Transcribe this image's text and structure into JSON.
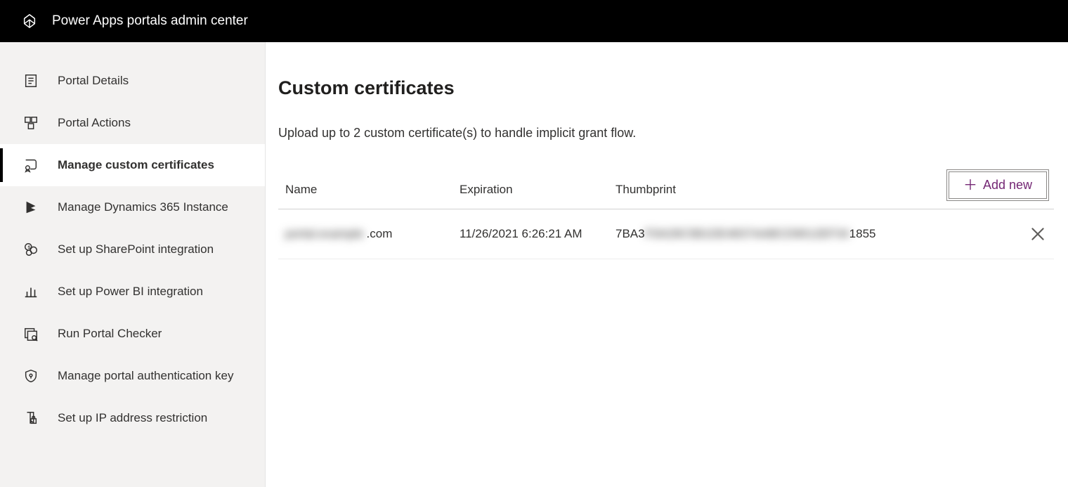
{
  "header": {
    "brand": "Power Apps portals admin center"
  },
  "sidebar": {
    "items": [
      {
        "label": "Portal Details",
        "icon": "details-icon"
      },
      {
        "label": "Portal Actions",
        "icon": "actions-icon"
      },
      {
        "label": "Manage custom certificates",
        "icon": "certificate-icon",
        "active": true
      },
      {
        "label": "Manage Dynamics 365 Instance",
        "icon": "dynamics-icon"
      },
      {
        "label": "Set up SharePoint integration",
        "icon": "sharepoint-icon"
      },
      {
        "label": "Set up Power BI integration",
        "icon": "powerbi-icon"
      },
      {
        "label": "Run Portal Checker",
        "icon": "checker-icon"
      },
      {
        "label": "Manage portal authentication key",
        "icon": "shield-icon"
      },
      {
        "label": "Set up IP address restriction",
        "icon": "ip-restriction-icon"
      }
    ]
  },
  "main": {
    "title": "Custom certificates",
    "subtitle": "Upload up to 2 custom certificate(s) to handle implicit grant flow.",
    "addButton": "Add new",
    "columns": {
      "name": "Name",
      "expiration": "Expiration",
      "thumbprint": "Thumbprint"
    },
    "rows": [
      {
        "name_hidden": "portal.example",
        "name_suffix": ".com",
        "expiration": "11/26/2021 6:26:21 AM",
        "thumbprint_prefix": "7BA3",
        "thumbprint_hidden": "F0A29C5B1DE4837AABCD9012EF34",
        "thumbprint_suffix": "1855"
      }
    ]
  }
}
